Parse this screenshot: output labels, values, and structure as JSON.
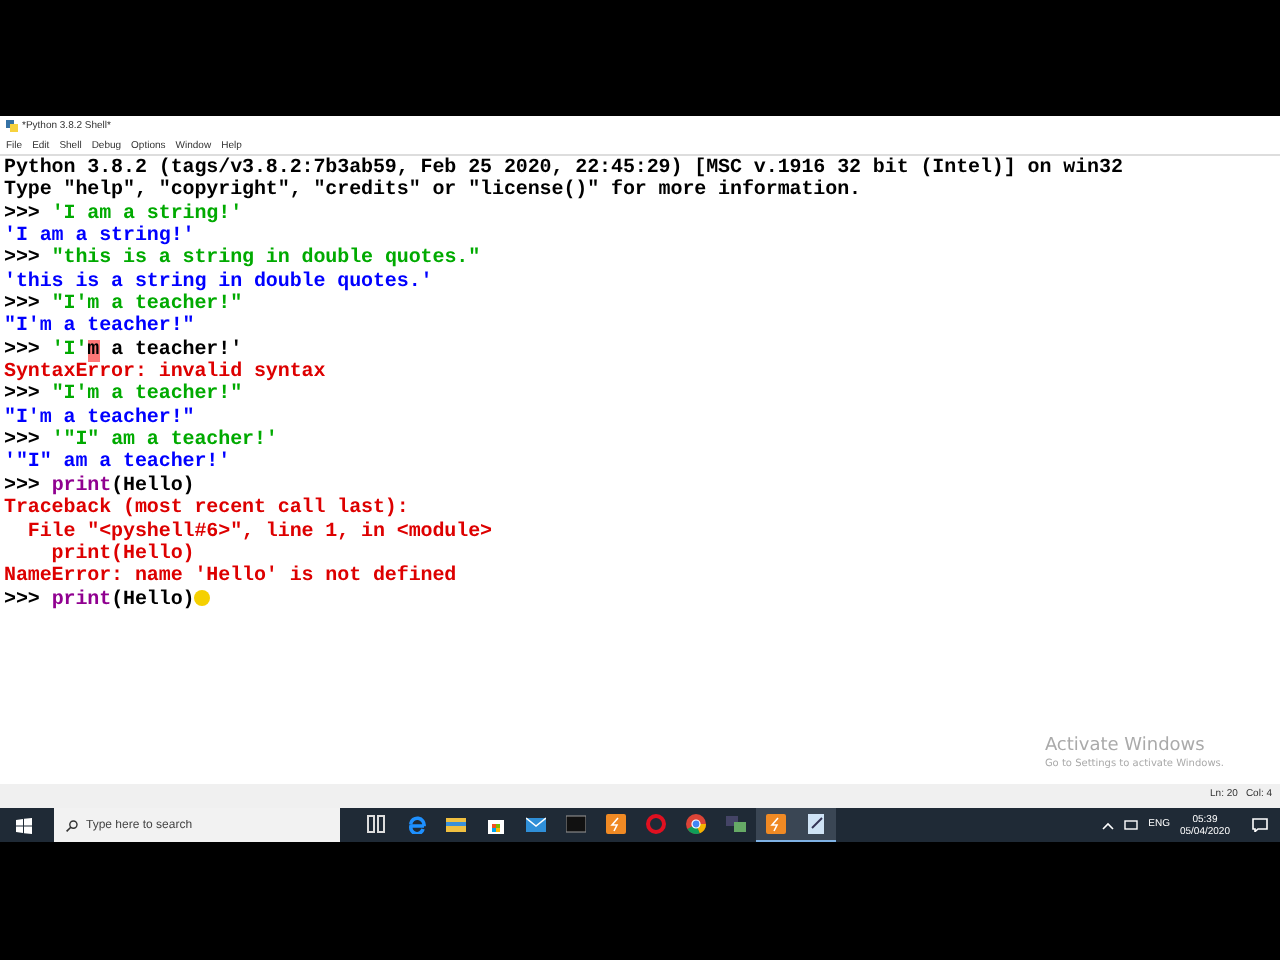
{
  "window": {
    "title": "*Python 3.8.2 Shell*"
  },
  "menu": [
    "File",
    "Edit",
    "Shell",
    "Debug",
    "Options",
    "Window",
    "Help"
  ],
  "shell_lines": [
    {
      "segments": [
        {
          "text": "Python 3.8.2 (tags/v3.8.2:7b3ab59, Feb 25 2020, 22:45:29) [MSC v.1916 32 bit (Intel)] on win32",
          "kind": "plain"
        }
      ]
    },
    {
      "segments": [
        {
          "text": "Type \"help\", \"copyright\", \"credits\" or \"license()\" for more information.",
          "kind": "plain"
        }
      ]
    },
    {
      "segments": [
        {
          "text": ">>> ",
          "kind": "prompt"
        },
        {
          "text": "'I am a string!'",
          "kind": "string"
        }
      ]
    },
    {
      "segments": [
        {
          "text": "'I am a string!'",
          "kind": "output"
        }
      ]
    },
    {
      "segments": [
        {
          "text": ">>> ",
          "kind": "prompt"
        },
        {
          "text": "\"this is a string in double quotes.\"",
          "kind": "string"
        }
      ]
    },
    {
      "segments": [
        {
          "text": "'this is a string in double quotes.'",
          "kind": "output"
        }
      ]
    },
    {
      "segments": [
        {
          "text": ">>> ",
          "kind": "prompt"
        },
        {
          "text": "\"I'm a teacher!\"",
          "kind": "string"
        }
      ]
    },
    {
      "segments": [
        {
          "text": "\"I'm a teacher!\"",
          "kind": "output"
        }
      ]
    },
    {
      "segments": [
        {
          "text": ">>> ",
          "kind": "prompt"
        },
        {
          "text": "'I'",
          "kind": "string"
        },
        {
          "text": "m",
          "kind": "error-mark"
        },
        {
          "text": " a teacher!'",
          "kind": "plain"
        }
      ]
    },
    {
      "segments": [
        {
          "text": "SyntaxError: invalid syntax",
          "kind": "error"
        }
      ]
    },
    {
      "segments": [
        {
          "text": ">>> ",
          "kind": "prompt"
        },
        {
          "text": "\"I'm a teacher!\"",
          "kind": "string"
        }
      ]
    },
    {
      "segments": [
        {
          "text": "\"I'm a teacher!\"",
          "kind": "output"
        }
      ]
    },
    {
      "segments": [
        {
          "text": ">>> ",
          "kind": "prompt"
        },
        {
          "text": "'\"I\" am a teacher!'",
          "kind": "string"
        }
      ]
    },
    {
      "segments": [
        {
          "text": "'\"I\" am a teacher!'",
          "kind": "output"
        }
      ]
    },
    {
      "segments": [
        {
          "text": ">>> ",
          "kind": "prompt"
        },
        {
          "text": "print",
          "kind": "builtin"
        },
        {
          "text": "(Hello)",
          "kind": "plain"
        }
      ]
    },
    {
      "segments": [
        {
          "text": "Traceback (most recent call last):",
          "kind": "error"
        }
      ]
    },
    {
      "segments": [
        {
          "text": "  File \"<pyshell#6>\", line 1, in <module>",
          "kind": "error"
        }
      ]
    },
    {
      "segments": [
        {
          "text": "    print(Hello)",
          "kind": "error"
        }
      ]
    },
    {
      "segments": [
        {
          "text": "NameError: name 'Hello' is not defined",
          "kind": "error"
        }
      ]
    },
    {
      "segments": [
        {
          "text": ">>> ",
          "kind": "prompt"
        },
        {
          "text": "print",
          "kind": "builtin"
        },
        {
          "text": "(Hello)",
          "kind": "plain"
        }
      ]
    }
  ],
  "activation_notice": {
    "title": "Activate Windows",
    "subtitle": "Go to Settings to activate Windows."
  },
  "status_bar": {
    "line": "Ln: 20",
    "column": "Col: 4"
  },
  "taskbar": {
    "search": {
      "placeholder": "Type here to search"
    },
    "apps": [
      {
        "kind": "task-view",
        "selected": false
      },
      {
        "kind": "browser-e",
        "selected": false
      },
      {
        "kind": "folder",
        "selected": false
      },
      {
        "kind": "store",
        "selected": false
      },
      {
        "kind": "mail",
        "selected": false
      },
      {
        "kind": "terminal",
        "selected": false
      },
      {
        "kind": "orange-tile",
        "selected": false
      },
      {
        "kind": "ring",
        "selected": false
      },
      {
        "kind": "chrome",
        "selected": false
      },
      {
        "kind": "network-app",
        "selected": false
      },
      {
        "kind": "orange-tile",
        "selected": true
      },
      {
        "kind": "notepad",
        "selected": true
      }
    ],
    "language": "ENG",
    "time": "05:39",
    "date": "05/04/2020"
  }
}
